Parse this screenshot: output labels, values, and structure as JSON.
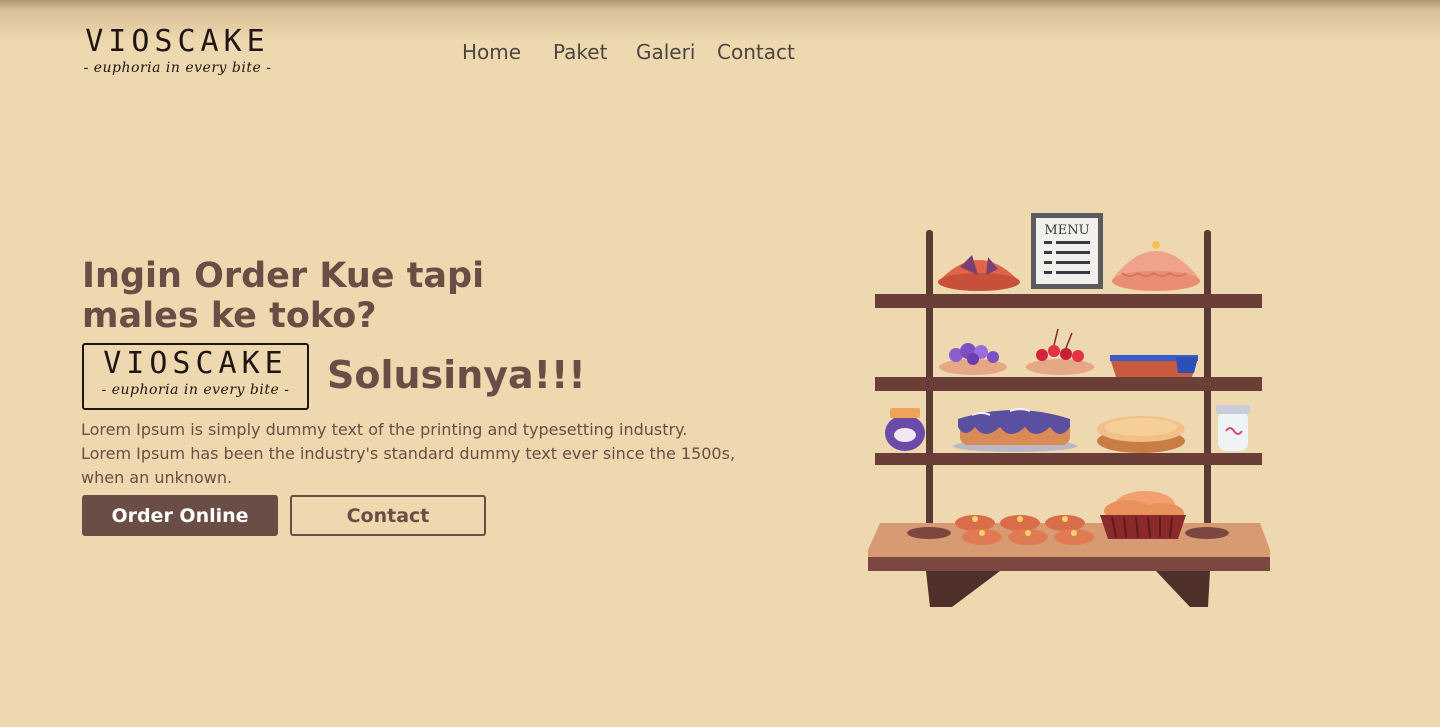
{
  "brand": {
    "name": "VIOSCAKE",
    "tagline": "- euphoria in every bite -"
  },
  "nav": {
    "items": [
      "Home",
      "Paket",
      "Galeri",
      "Contact"
    ]
  },
  "hero": {
    "title": "Ingin Order Kue tapi males ke toko?",
    "badge_name": "VIOSCAKE",
    "badge_tagline": "- euphoria in every bite -",
    "solution": "Solusinya!!!",
    "description": "Lorem Ipsum is simply dummy text of the printing and typesetting industry. Lorem Ipsum has been the industry's standard dummy text ever since the 1500s, when an unknown.",
    "order_button": "Order Online",
    "contact_button": "Contact"
  },
  "illustration": {
    "menu_board_text": "MENU"
  },
  "colors": {
    "background": "#eed8af",
    "primary": "#6a4d45",
    "logo_ink": "#1f1512",
    "nav_text": "#4e4540"
  }
}
